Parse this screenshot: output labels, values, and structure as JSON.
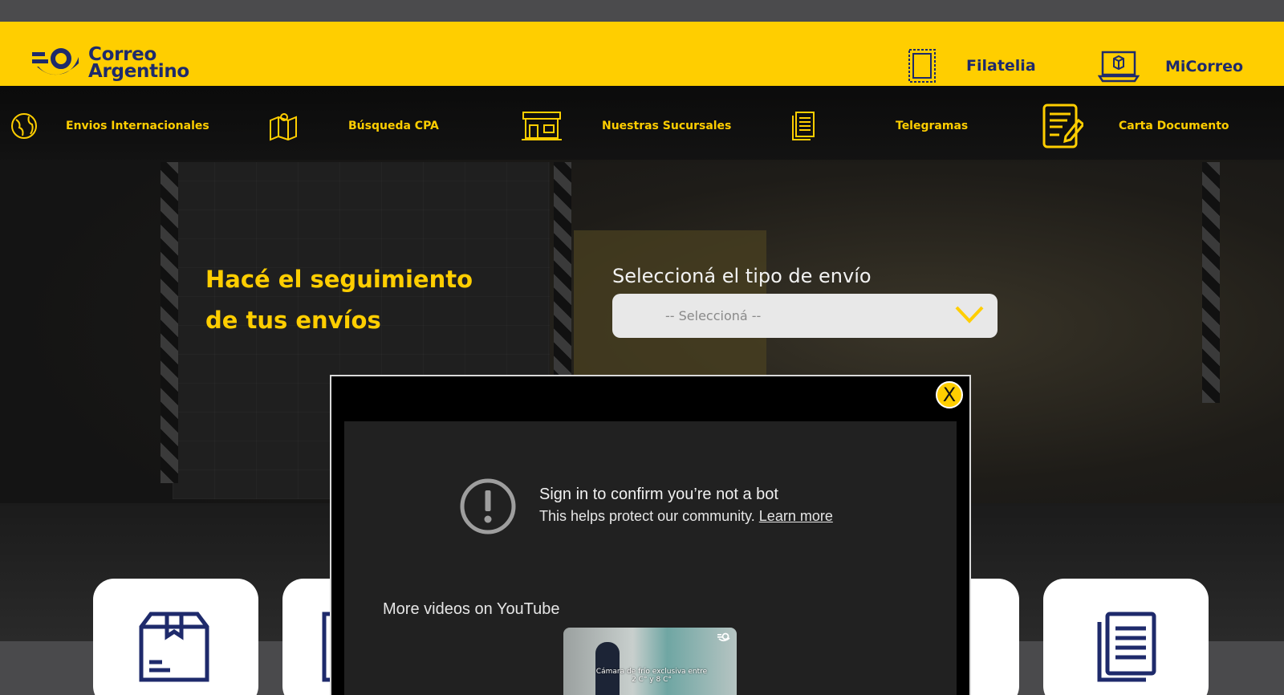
{
  "header": {
    "brand_line1": "Correo",
    "brand_line2": "Argentino",
    "links": [
      {
        "label": "Filatelia",
        "icon": "stamp-icon"
      },
      {
        "label": "MiCorreo",
        "icon": "laptop-box-icon"
      }
    ]
  },
  "nav": {
    "items": [
      {
        "label": "Envios Internacionales",
        "icon": "globe-icon"
      },
      {
        "label": "Búsqueda CPA",
        "icon": "map-pin-icon"
      },
      {
        "label": "Nuestras Sucursales",
        "icon": "branch-building-icon"
      },
      {
        "label": "Telegramas",
        "icon": "document-lines-icon"
      },
      {
        "label": "Carta Documento",
        "icon": "document-edit-icon"
      }
    ]
  },
  "hero": {
    "title_line1": "Hacé el seguimiento",
    "title_line2": "de tus envíos",
    "select_label": "Seleccioná el tipo de envío",
    "select_value": "-- Seleccioná --"
  },
  "modal": {
    "close_label": "X",
    "yt_title": "Sign in to confirm you’re not a bot",
    "yt_sub": "This helps protect our community.",
    "yt_learn_more": "Learn more",
    "yt_more_videos": "More videos on YouTube",
    "thumb_caption": "Cámara de frío exclusiva entre 2 C° y 8 C°"
  },
  "colors": {
    "brand_yellow": "#ffce00",
    "brand_navy": "#1e2a6b"
  }
}
